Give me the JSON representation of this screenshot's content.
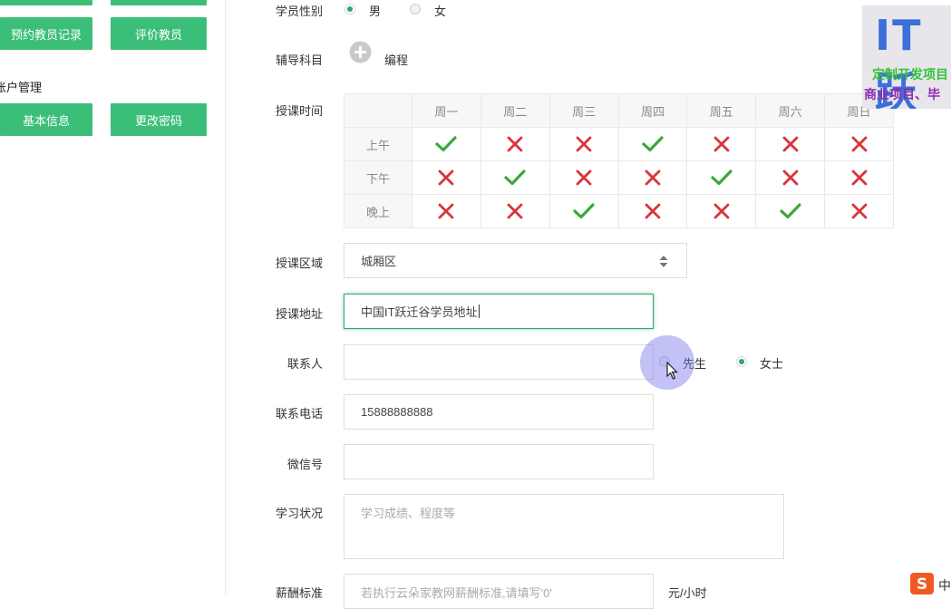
{
  "sidebar": {
    "top_buttons": [
      "预约教员记录",
      "评价教员"
    ],
    "section_title": "账户管理",
    "account_buttons": [
      "基本信息",
      "更改密码"
    ]
  },
  "form": {
    "gender": {
      "label": "学员性别",
      "options": [
        "男",
        "女"
      ],
      "selected": "男"
    },
    "subject": {
      "label": "辅导科目",
      "value": "编程"
    },
    "schedule": {
      "label": "授课时间",
      "days": [
        "周一",
        "周二",
        "周三",
        "周四",
        "周五",
        "周六",
        "周日"
      ],
      "rows": [
        {
          "name": "上午",
          "marks": [
            "check",
            "cross",
            "cross",
            "check",
            "cross",
            "cross",
            "cross"
          ]
        },
        {
          "name": "下午",
          "marks": [
            "cross",
            "check",
            "cross",
            "cross",
            "check",
            "cross",
            "cross"
          ]
        },
        {
          "name": "晚上",
          "marks": [
            "cross",
            "cross",
            "check",
            "cross",
            "cross",
            "check",
            "cross"
          ]
        }
      ]
    },
    "district": {
      "label": "授课区域",
      "value": "城厢区"
    },
    "address": {
      "label": "授课地址",
      "value": "中国IT跃迁谷学员地址"
    },
    "contact": {
      "label": "联系人",
      "value": "",
      "options": [
        "先生",
        "女士"
      ],
      "selected": "女士"
    },
    "phone": {
      "label": "联系电话",
      "value": "15888888888"
    },
    "wechat": {
      "label": "微信号",
      "value": ""
    },
    "study_status": {
      "label": "学习状况",
      "placeholder": "学习成绩、程度等"
    },
    "salary": {
      "label": "薪酬标准",
      "placeholder": "若执行云朵家教网薪酬标准,请填写'0'",
      "unit": "元/小时"
    }
  },
  "watermark": {
    "line1": "IT跃",
    "line2": "定制开发项目",
    "line3": "商业项目、毕"
  },
  "ime": {
    "label": "中"
  },
  "colors": {
    "accent": "#3bbf78",
    "check": "#3aa83a",
    "cross": "#d9343a"
  }
}
